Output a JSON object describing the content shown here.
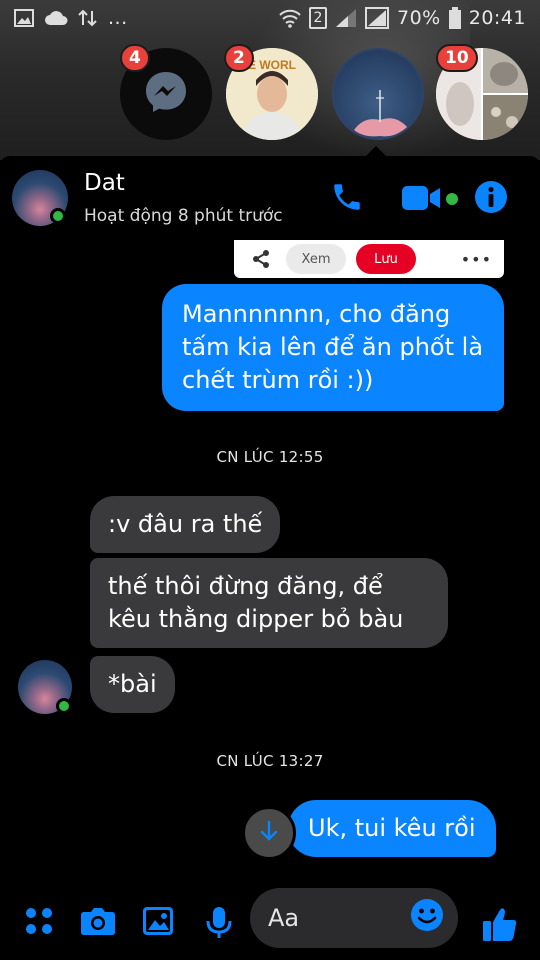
{
  "status_bar": {
    "left_icons": [
      "image-icon",
      "cloud-icon",
      "data-transfer-icon",
      "more-dots-icon"
    ],
    "more_text": "...",
    "sim_label": "2",
    "battery": "70%",
    "time": "20:41"
  },
  "chat_heads": [
    {
      "name": "messenger-head",
      "badge": "4"
    },
    {
      "name": "contact-head-2",
      "badge": "2",
      "image_text": "PE WORL"
    },
    {
      "name": "contact-head-active",
      "badge": ""
    },
    {
      "name": "group-head",
      "badge": "10"
    }
  ],
  "header": {
    "name": "Dat",
    "status": "Hoạt động 8 phút trước",
    "accent": "#0a84ff"
  },
  "share_card": {
    "xem_label": "Xem",
    "luu_label": "Lưu",
    "more_label": "•••"
  },
  "messages": [
    {
      "type": "out",
      "text": "Mannnnnnn, cho đăng tấm kia lên để ăn phốt là chết trùm rồi :))"
    },
    {
      "type": "timestamp",
      "text": "CN LÚC 12:55"
    },
    {
      "type": "in",
      "text": ":v đâu ra thế"
    },
    {
      "type": "in",
      "text": "thế thôi đừng đăng, để kêu thằng dipper bỏ bàu"
    },
    {
      "type": "in",
      "text": "*bài"
    },
    {
      "type": "timestamp",
      "text": "CN LÚC 13:27"
    },
    {
      "type": "out",
      "text": "Uk, tui kêu rồi"
    }
  ],
  "composer": {
    "placeholder": "Aa"
  },
  "colors": {
    "outgoing": "#0a84ff",
    "incoming": "#3a3a3c",
    "online": "#31b943",
    "badge": "#e8403a"
  }
}
